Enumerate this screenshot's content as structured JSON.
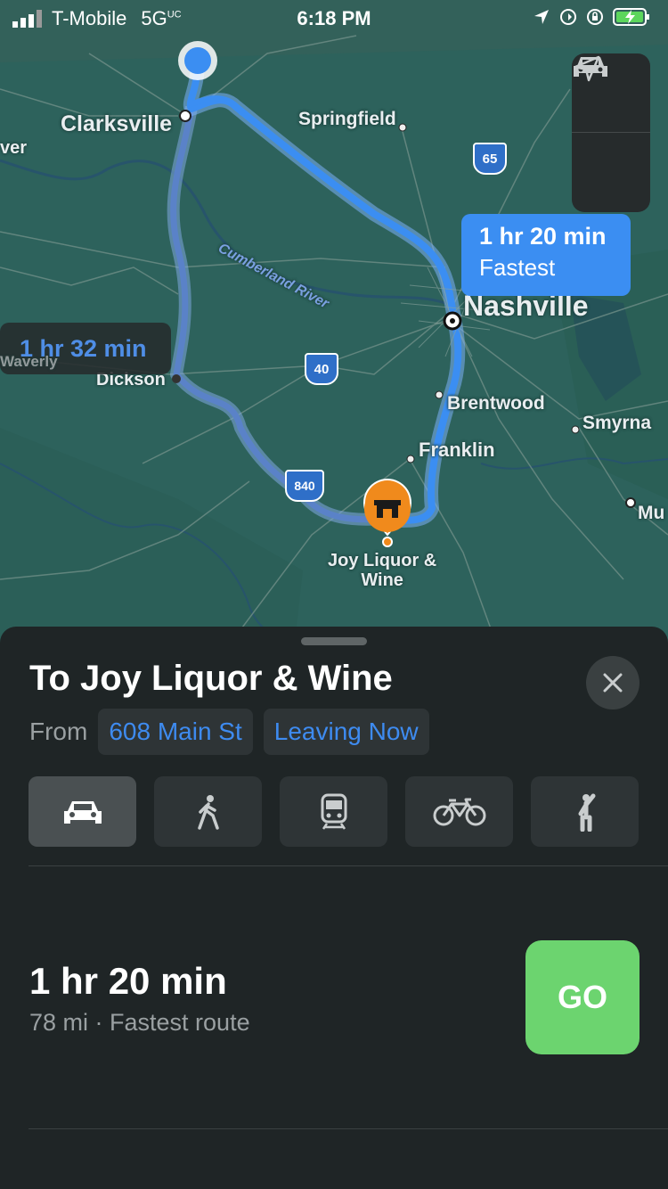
{
  "status": {
    "carrier": "T-Mobile",
    "network": "5G",
    "network_sup": "UC",
    "time": "6:18 PM"
  },
  "map": {
    "labels": {
      "clarksville": "Clarksville",
      "springfield": "Springfield",
      "nashville": "Nashville",
      "dickson": "Dickson",
      "brentwood": "Brentwood",
      "smyrna": "Smyrna",
      "franklin": "Franklin",
      "mu": "Mu",
      "waverly": "Waverly",
      "ver": "ver",
      "river": "Cumberland River",
      "destination": "Joy Liquor &",
      "destination2": "Wine"
    },
    "shields": {
      "i65": "65",
      "i40": "40",
      "i840": "840"
    },
    "fastest_callout": {
      "time": "1 hr 20 min",
      "label": "Fastest"
    },
    "alt_callout": {
      "time": "1 hr 32 min"
    },
    "colors": {
      "route": "#3b8ef2",
      "alt_route": "#5f86c9",
      "poi": "#f08a1c"
    }
  },
  "sheet": {
    "title": "To Joy Liquor & Wine",
    "from_label": "From",
    "from_value": "608 Main St",
    "when_value": "Leaving Now",
    "modes": [
      "drive",
      "walk",
      "transit",
      "cycle",
      "rideshare"
    ],
    "route_time": "1 hr 20 min",
    "route_sub": "78 mi · Fastest route",
    "go_label": "GO"
  }
}
